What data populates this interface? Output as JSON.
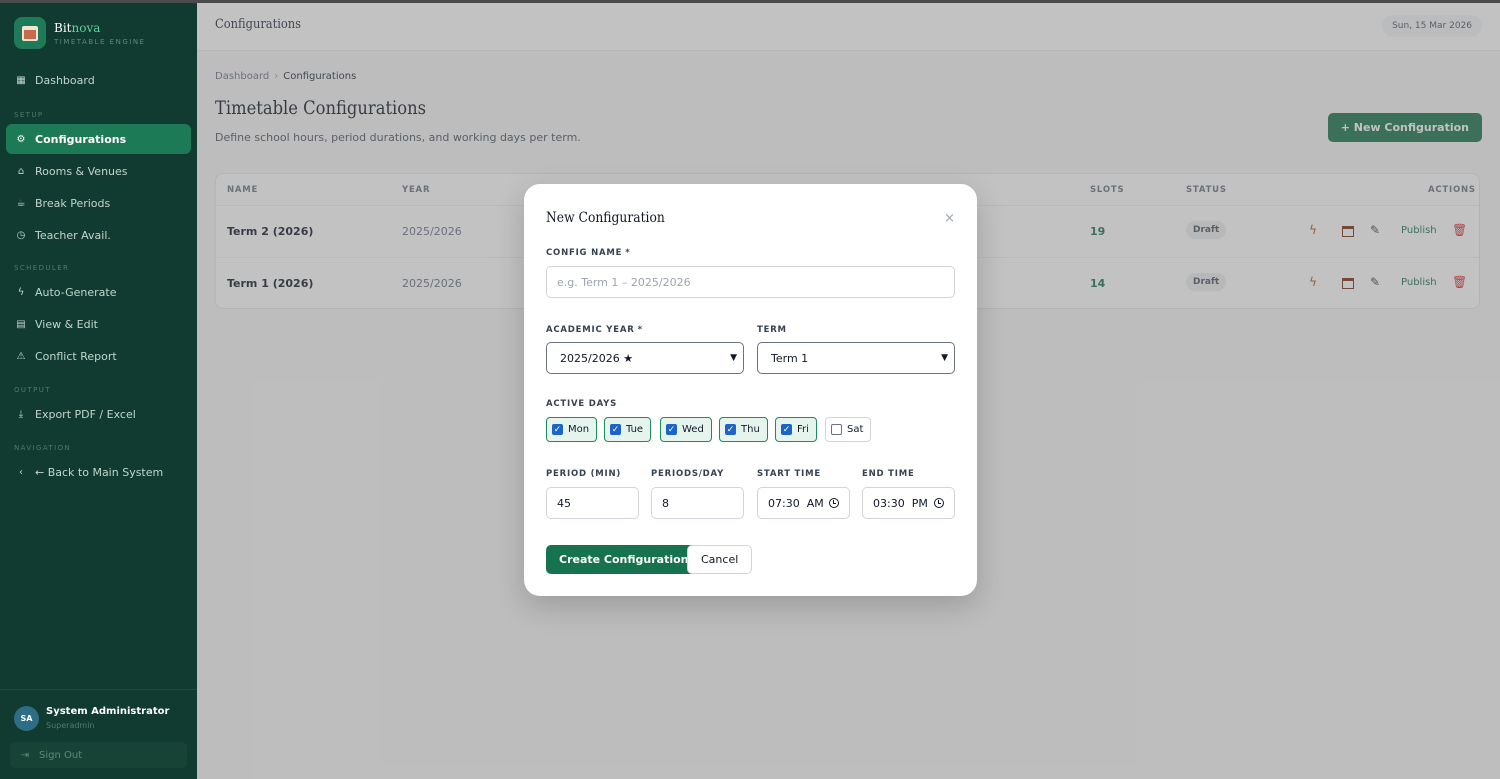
{
  "brand": {
    "name_prefix": "Bit",
    "name_suffix": "nova",
    "subtitle": "TIMETABLE ENGINE"
  },
  "nav": {
    "dashboard": "Dashboard",
    "section_setup": "SETUP",
    "configurations": "Configurations",
    "rooms": "Rooms & Venues",
    "breaks": "Break Periods",
    "teacher": "Teacher Avail.",
    "section_scheduler": "SCHEDULER",
    "autogen": "Auto-Generate",
    "view_edit": "View & Edit",
    "conflict": "Conflict Report",
    "section_output": "OUTPUT",
    "export": "Export PDF / Excel",
    "section_navigation": "NAVIGATION",
    "back": "← Back to Main System"
  },
  "user": {
    "initials": "SA",
    "name": "System Administrator",
    "role": "Superadmin",
    "signout": "Sign Out"
  },
  "topbar": {
    "title": "Configurations",
    "date": "Sun, 15 Mar 2026"
  },
  "breadcrumb": {
    "home": "Dashboard",
    "current": "Configurations"
  },
  "page": {
    "title": "Timetable Configurations",
    "subtitle": "Define school hours, period durations, and working days per term.",
    "new_button": "+ New Configuration"
  },
  "table": {
    "headers": {
      "name": "NAME",
      "year": "YEAR",
      "slots": "SLOTS",
      "status": "STATUS",
      "actions": "ACTIONS"
    },
    "rows": [
      {
        "name": "Term 2 (2026)",
        "year": "2025/2026",
        "slots": "19",
        "status": "Draft",
        "publish": "Publish"
      },
      {
        "name": "Term 1 (2026)",
        "year": "2025/2026",
        "slots": "14",
        "status": "Draft",
        "publish": "Publish"
      }
    ]
  },
  "modal": {
    "title": "New Configuration",
    "close": "×",
    "config_name_label": "CONFIG NAME",
    "required": "*",
    "config_name_placeholder": "e.g. Term 1 – 2025/2026",
    "academic_year_label": "ACADEMIC YEAR",
    "academic_year_value": "2025/2026 ★",
    "term_label": "TERM",
    "term_value": "Term 1",
    "active_days_label": "ACTIVE DAYS",
    "days": [
      {
        "label": "Mon",
        "checked": true
      },
      {
        "label": "Tue",
        "checked": true
      },
      {
        "label": "Wed",
        "checked": true
      },
      {
        "label": "Thu",
        "checked": true
      },
      {
        "label": "Fri",
        "checked": true
      },
      {
        "label": "Sat",
        "checked": false
      }
    ],
    "period_label": "PERIOD (MIN)",
    "period_value": "45",
    "periods_day_label": "PERIODS/DAY",
    "periods_day_value": "8",
    "start_label": "START TIME",
    "start_value": "07:30  AM",
    "end_label": "END TIME",
    "end_value": "03:30  PM",
    "create_button": "Create Configuration",
    "cancel_button": "Cancel"
  },
  "colors": {
    "sidebar": "#113a30",
    "accent": "#17734f",
    "active_nav": "#1d7a56",
    "checkbox": "#1e64c8"
  }
}
